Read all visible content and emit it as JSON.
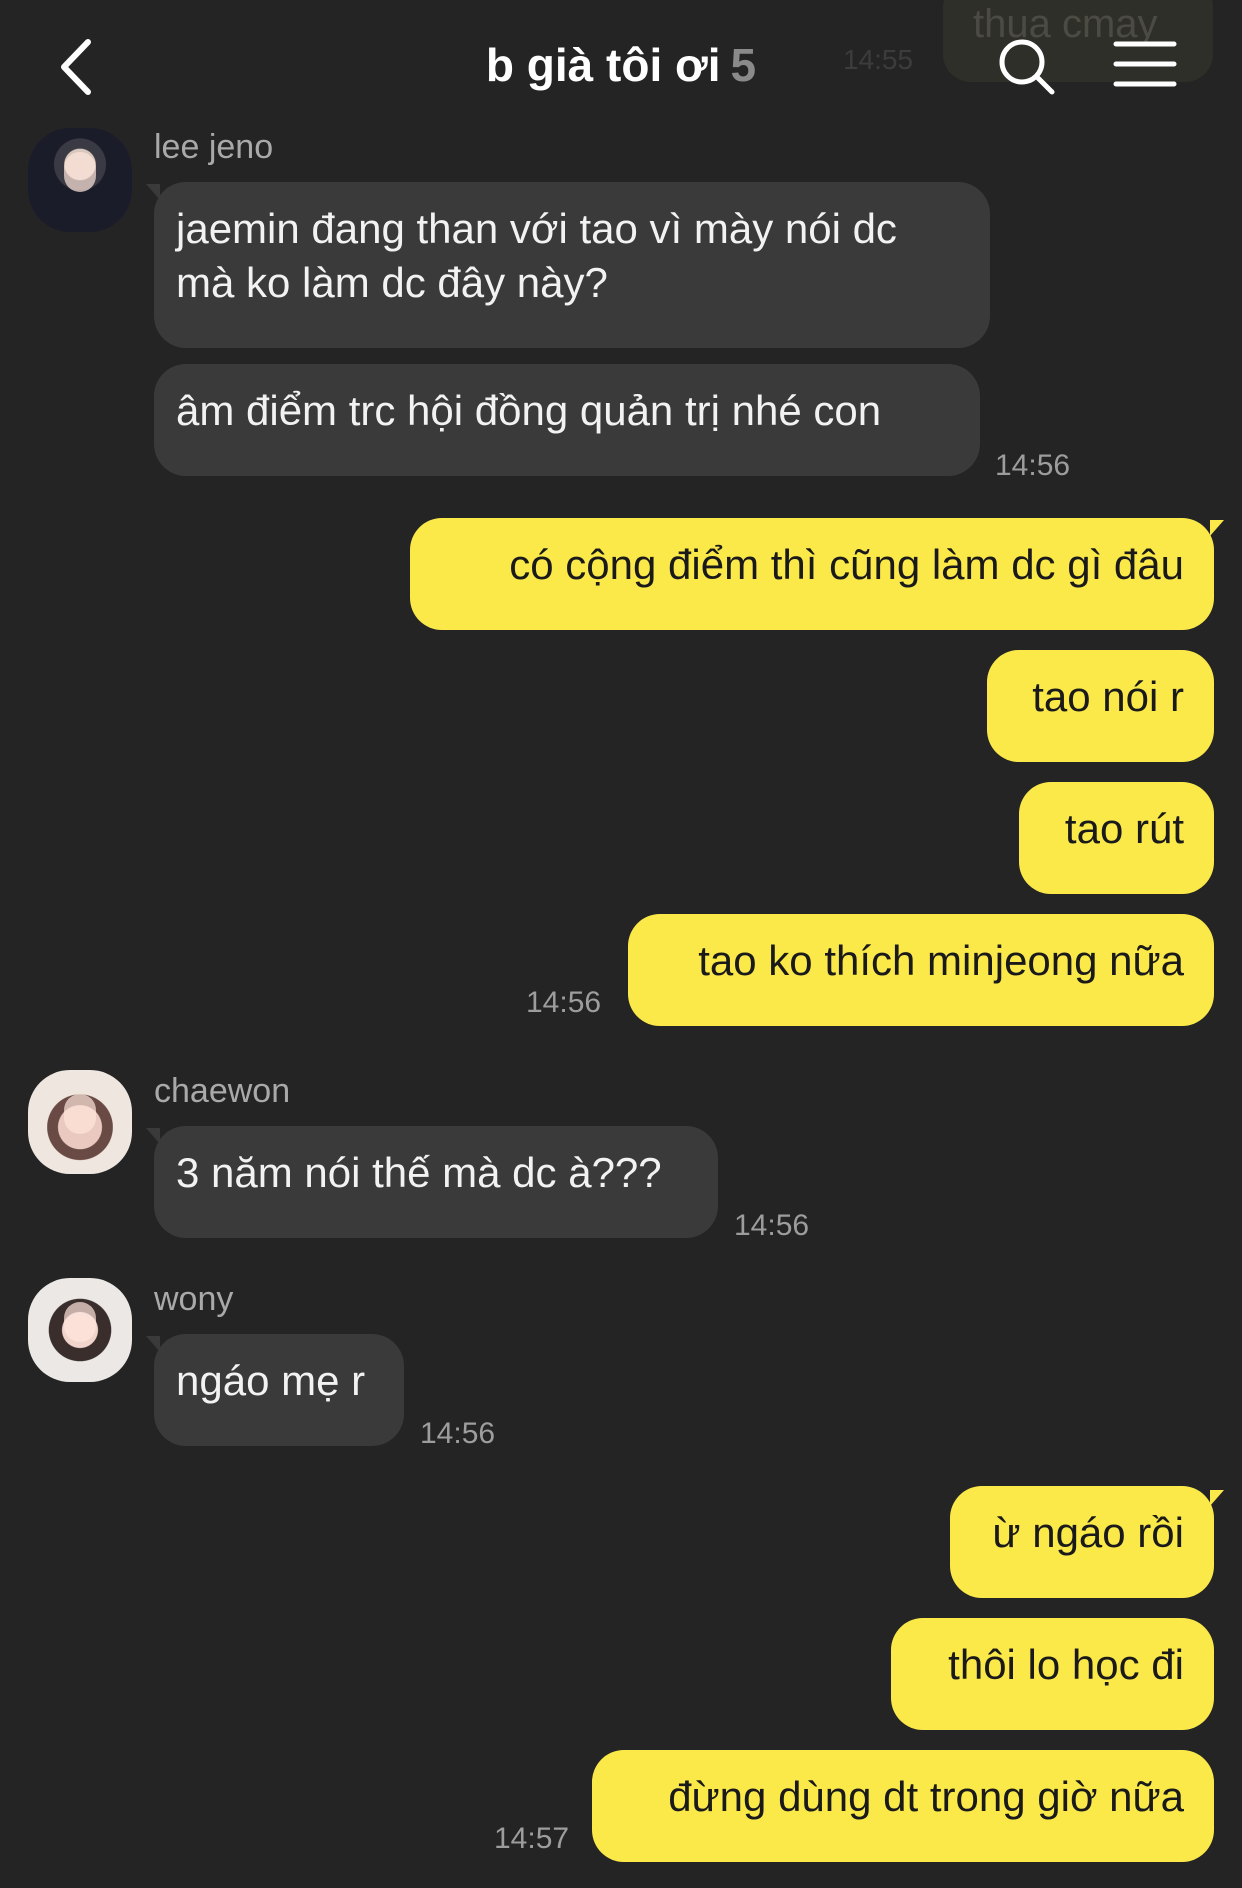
{
  "header": {
    "title": "b già tôi ơi",
    "member_count": "5",
    "back_icon": "chevron-left-icon",
    "search_icon": "search-icon",
    "menu_icon": "menu-icon",
    "previous_message_text": "thua cmay",
    "previous_message_time": "14:55"
  },
  "messages": [
    {
      "sender": "lee jeno",
      "lines": [
        "jaemin đang than với tao vì mày nói dc",
        "mà ko làm dc đây này?"
      ]
    },
    {
      "text": "âm điểm trc hội đồng quản trị nhé con",
      "time": "14:56"
    },
    {
      "text": "có cộng điểm thì cũng làm dc gì đâu"
    },
    {
      "text": "tao nói r"
    },
    {
      "text": "tao rút"
    },
    {
      "text": "tao ko thích minjeong nữa",
      "time": "14:56"
    },
    {
      "sender": "chaewon",
      "text": "3 năm nói thế mà dc à???",
      "time": "14:56"
    },
    {
      "sender": "wony",
      "text": "ngáo mẹ r",
      "time": "14:56"
    },
    {
      "text": "ừ ngáo rồi"
    },
    {
      "text": "thôi lo học đi"
    },
    {
      "text": "đừng dùng dt trong giờ nữa",
      "time": "14:57"
    }
  ],
  "colors": {
    "background": "#242424",
    "incoming_bubble": "#3a3a3a",
    "outgoing_bubble": "#fbe94a"
  }
}
